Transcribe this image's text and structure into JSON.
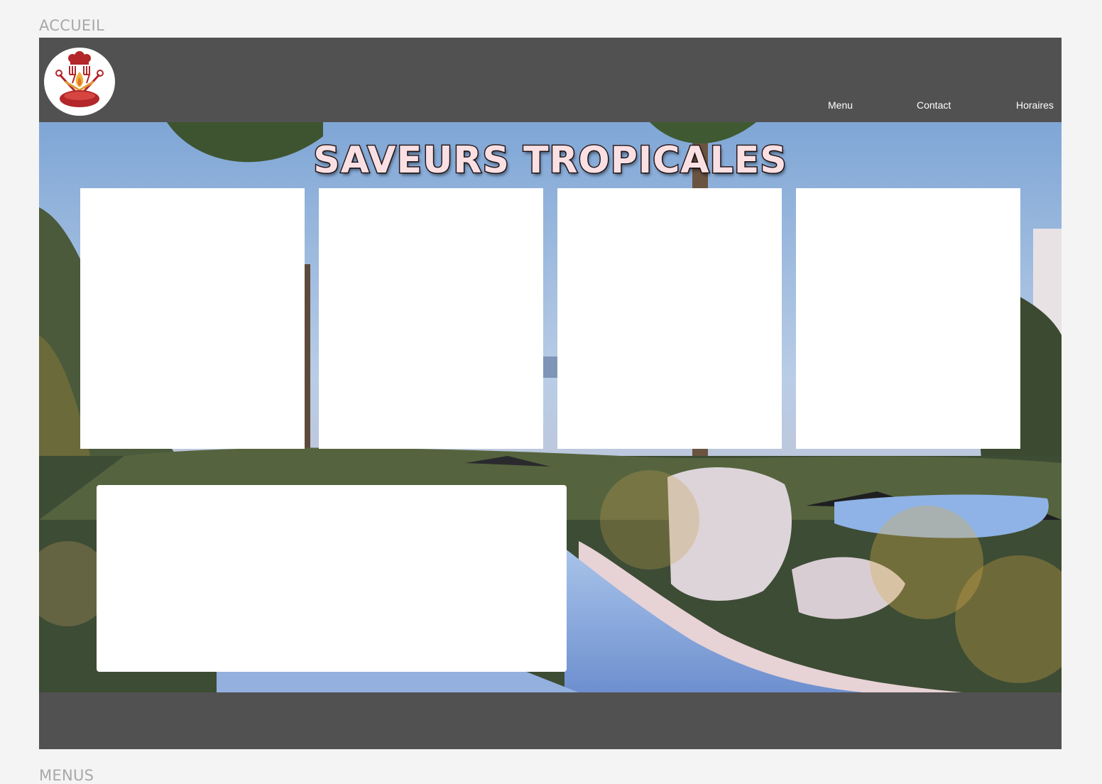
{
  "frames": {
    "top_label": "ACCUEIL",
    "bottom_label": "MENUS"
  },
  "header": {
    "logo_icon": "chef-hat-utensils-logo",
    "nav": {
      "menu": "Menu",
      "contact": "Contact",
      "hours": "Horaires"
    }
  },
  "hero": {
    "title": "SAVEURS TROPICALES",
    "background": "tropical resort pool at dusk"
  },
  "colors": {
    "page_background": "#f4f4f4",
    "header_footer": "#525152",
    "title_fill": "#fbe0e3",
    "logo_red": "#b3262a"
  }
}
